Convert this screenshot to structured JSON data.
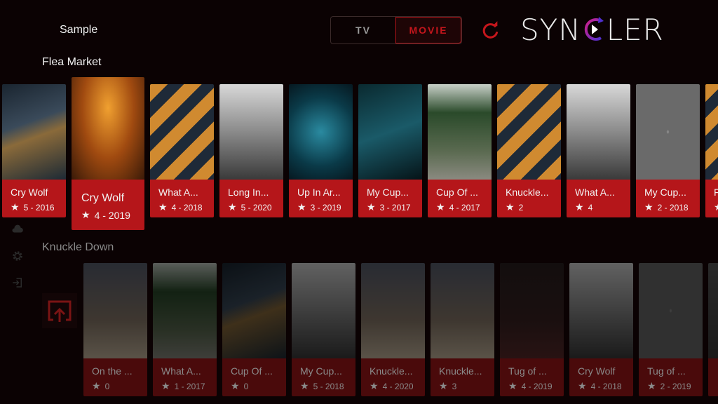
{
  "header": {
    "profile": "Sample",
    "toggle": {
      "tv": "TV",
      "movie": "MOVIE",
      "selected": "MOVIE"
    },
    "logo": {
      "pre": "SYN",
      "post": "LER"
    },
    "accent": "#c4161c"
  },
  "rows": [
    {
      "title": "Flea Market",
      "items": [
        {
          "title": "Cry Wolf",
          "meta": "5 - 2016",
          "bg": "linear-gradient(160deg,#1a2530,#3a4a5a 40%,#8a6a3a 55%,#1d2a35)"
        },
        {
          "title": "Cry Wolf",
          "meta": "4 - 2019",
          "bg": "radial-gradient(ellipse at 50% 30%,#f0a030,#a04a10 50%,#3a1a08)",
          "focused": true
        },
        {
          "title": "What A...",
          "meta": "4 - 2018",
          "bg": "repeating-linear-gradient(135deg,#d08a30 0 18px,#1e2a38 18px 34px)"
        },
        {
          "title": "Long In...",
          "meta": "5 - 2020",
          "bg": "linear-gradient(180deg,#d8d8d8,#8a8a8a 50%,#3a3a3a)"
        },
        {
          "title": "Up In Ar...",
          "meta": "3 - 2019",
          "bg": "radial-gradient(circle at 50% 50%,#2a8aa0,#0a3a48 60%,#061820)"
        },
        {
          "title": "My Cup...",
          "meta": "3 - 2017",
          "bg": "linear-gradient(160deg,#0a2a30,#1a5a68 50%,#051418)"
        },
        {
          "title": "Cup Of ...",
          "meta": "4 - 2017",
          "bg": "linear-gradient(180deg,#c8d0c8,#2a4a2a 30%,#5a6a50 70%,#8a8a80)"
        },
        {
          "title": "Knuckle...",
          "meta": "2",
          "bg": "repeating-linear-gradient(135deg,#d08a30 0 18px,#1e2a38 18px 34px)"
        },
        {
          "title": "What A...",
          "meta": "4",
          "bg": "linear-gradient(180deg,#d8d8d8,#8a8a8a 50%,#3a3a3a)"
        },
        {
          "title": "My Cup...",
          "meta": "2 - 2018",
          "bg": "radial-gradient(#8a8a8a 1px,#6a6a6a 2px)"
        },
        {
          "title": "Flea...",
          "meta": "",
          "bg": "repeating-linear-gradient(135deg,#d08a30 0 18px,#1e2a38 18px 34px)"
        }
      ]
    },
    {
      "title": "Knuckle Down",
      "items": [
        {
          "title": "On the ...",
          "meta": "0",
          "bg": "linear-gradient(180deg,#5a6070,#8a7a6a 60%,#c8b8a0)"
        },
        {
          "title": "What A...",
          "meta": "1 - 2017",
          "bg": "linear-gradient(180deg,#c8d0c8,#2a4a2a 30%,#5a6a50 70%,#8a8a80)"
        },
        {
          "title": "Cup Of ...",
          "meta": "0",
          "bg": "linear-gradient(160deg,#1a2530,#3a4a5a 40%,#8a6a3a 55%,#1d2a35)"
        },
        {
          "title": "My Cup...",
          "meta": "5 - 2018",
          "bg": "linear-gradient(180deg,#d8d8d8,#8a8a8a 50%,#3a3a3a)"
        },
        {
          "title": "Knuckle...",
          "meta": "4 - 2020",
          "bg": "linear-gradient(180deg,#5a6070,#8a7a6a 60%,#c8b8a0)"
        },
        {
          "title": "Knuckle...",
          "meta": "3",
          "bg": "linear-gradient(180deg,#5a6070,#8a7a6a 60%,#c8b8a0)"
        },
        {
          "title": "Tug of ...",
          "meta": "4 - 2019",
          "bg": "linear-gradient(180deg,#2a2020,#3a2222 60%,#5a2a2a)"
        },
        {
          "title": "Cry Wolf",
          "meta": "4 - 2018",
          "bg": "linear-gradient(180deg,#d8d8d8,#8a8a8a 50%,#3a3a3a)"
        },
        {
          "title": "Tug of ...",
          "meta": "2 - 2019",
          "bg": "radial-gradient(#8a8a8a 1px,#6a6a6a 2px)"
        },
        {
          "title": "",
          "meta": "",
          "bg": "linear-gradient(180deg,#5a5a5a,#3a3a3a)"
        }
      ]
    }
  ],
  "sidebar": [
    "cloud-icon",
    "gear-icon",
    "logout-icon"
  ],
  "cast_button": "cast-icon"
}
